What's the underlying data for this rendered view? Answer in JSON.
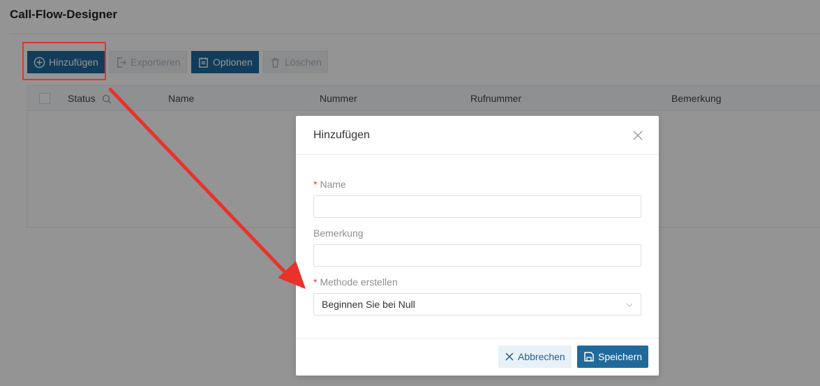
{
  "page": {
    "title": "Call-Flow-Designer"
  },
  "toolbar": {
    "add_label": "Hinzufügen",
    "export_label": "Exportieren",
    "options_label": "Optionen",
    "delete_label": "Löschen"
  },
  "table": {
    "columns": [
      "Status",
      "Name",
      "Nummer",
      "Rufnummer",
      "Bemerkung"
    ]
  },
  "modal": {
    "title": "Hinzufügen",
    "fields": {
      "name_label": "Name",
      "name_value": "",
      "remark_label": "Bemerkung",
      "remark_value": "",
      "method_label": "Methode erstellen",
      "method_value": "Beginnen Sie bei Null"
    },
    "required_marker": "*",
    "cancel_label": "Abbrechen",
    "save_label": "Speichern"
  },
  "colors": {
    "primary": "#1f6a9b",
    "annotation_red": "#e8322b"
  },
  "icons": {
    "add": "plus-circle-icon",
    "export": "export-icon",
    "options": "clipboard-icon",
    "delete": "trash-icon",
    "search": "search-icon",
    "close": "close-icon",
    "chevron": "chevron-down-icon",
    "cancel": "x-icon",
    "save": "save-icon"
  }
}
